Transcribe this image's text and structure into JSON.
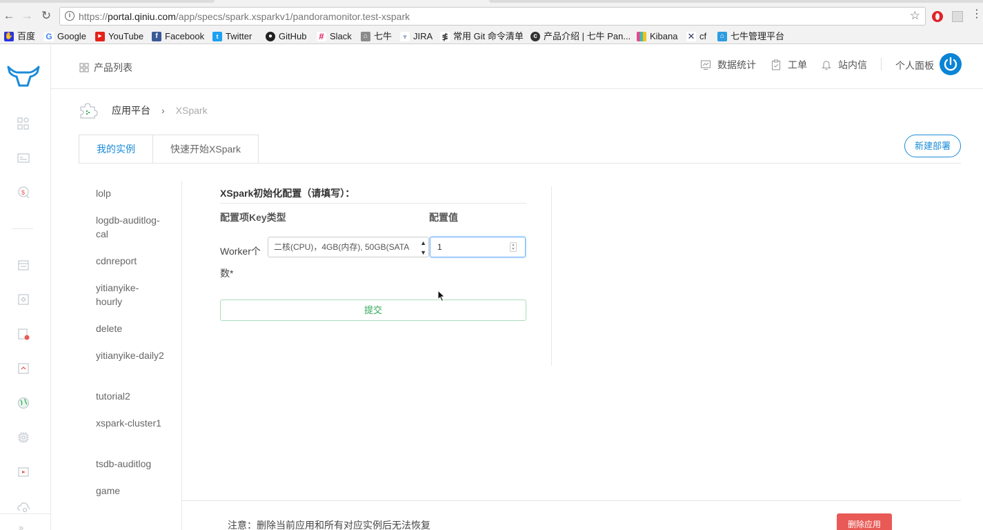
{
  "browser": {
    "url_prefix": "https://",
    "url_host": "portal.qiniu.com",
    "url_path": "/app/specs/spark.xsparkv1/pandoramonitor.test-xspark",
    "bookmarks": [
      "百度",
      "Google",
      "YouTube",
      "Facebook",
      "Twitter",
      "GitHub",
      "Slack",
      "七牛",
      "JIRA",
      "常用 Git 命令清单",
      "产品介绍 | 七牛 Pan...",
      "Kibana",
      "cf",
      "七牛管理平台"
    ]
  },
  "header": {
    "products": "产品列表",
    "stats": "数据统计",
    "tickets": "工单",
    "messages": "站内信",
    "personal": "个人面板"
  },
  "breadcrumb": {
    "level1": "应用平台",
    "level2": "XSpark"
  },
  "tabs": {
    "my_instances": "我的实例",
    "quick_start": "快速开始XSpark"
  },
  "new_deploy": "新建部署",
  "instances": [
    "lolp",
    "logdb-auditlog-cal",
    "cdnreport",
    "yitianyike-hourly",
    "delete",
    "yitianyike-daily2",
    "tutorial2",
    "xspark-cluster1",
    "tsdb-auditlog",
    "game"
  ],
  "config": {
    "title": "XSpark初始化配置（请填写）：",
    "col_key": "配置项Key类型",
    "col_value": "配置值",
    "field_label": "Worker个数*",
    "type_value": "二核(CPU)，4GB(内存), 50GB(SATA",
    "worker_count": "1",
    "submit": "提交"
  },
  "notice": "注意：删除当前应用和所有对应实例后无法恢复",
  "delete_app": "删除应用",
  "colors": {
    "primary": "#1a8bd8",
    "success": "#2fa857",
    "danger": "#e95a56"
  }
}
